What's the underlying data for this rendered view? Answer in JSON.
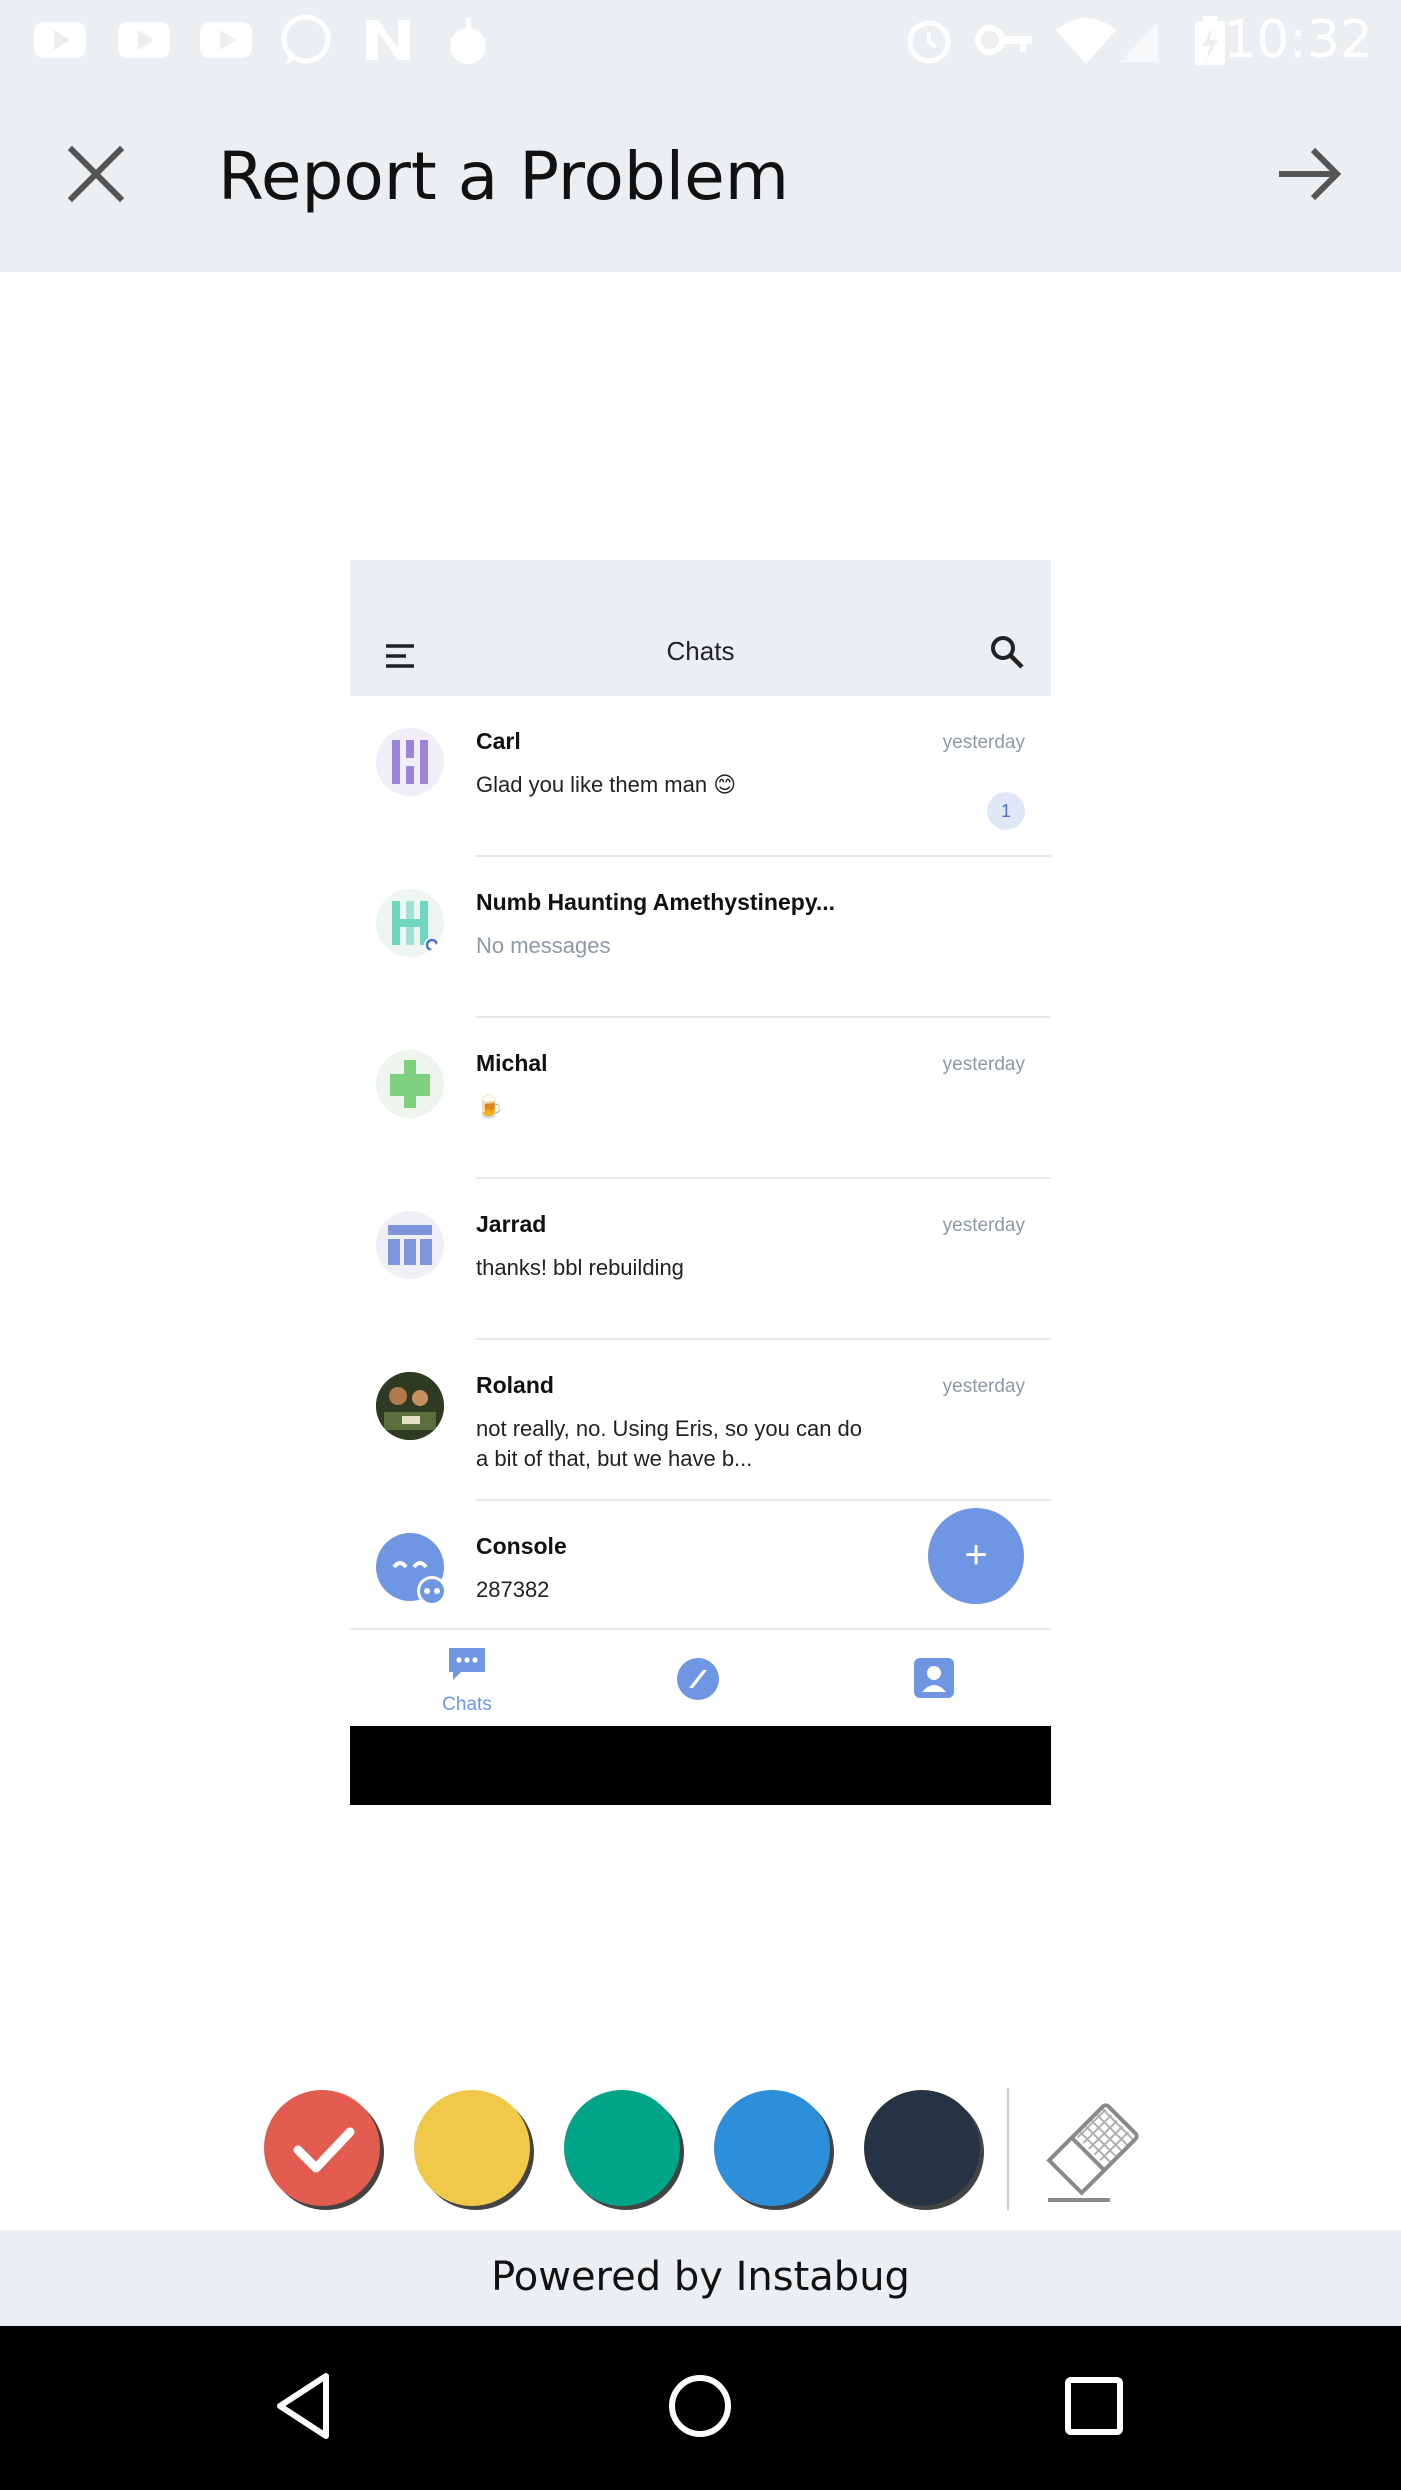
{
  "status_bar": {
    "time": "10:32",
    "icons": [
      "youtube-icon",
      "youtube-icon",
      "youtube-icon",
      "whatsapp-icon",
      "n-icon",
      "bomb-icon",
      "alarm-icon",
      "key-icon",
      "wifi-icon",
      "signal-icon",
      "battery-icon"
    ]
  },
  "app_bar": {
    "title": "Report a Problem",
    "close_icon": "close-icon",
    "next_icon": "arrow-right-icon"
  },
  "screenshot": {
    "header_title": "Chats",
    "chats": [
      {
        "name": "Carl",
        "message": "Glad you like them man 😊",
        "time": "yesterday",
        "badge": "1",
        "avatar_color": "#9c84d8"
      },
      {
        "name": "Numb Haunting Amethystinepy...",
        "message": "No messages",
        "time": "",
        "badge": "",
        "avatar_color": "#6fd6bf"
      },
      {
        "name": "Michal",
        "message": "🍺",
        "time": "yesterday",
        "badge": "",
        "avatar_color": "#7fd07c"
      },
      {
        "name": "Jarrad",
        "message": "thanks! bbl rebuilding",
        "time": "yesterday",
        "badge": "",
        "avatar_color": "#7f95dc"
      },
      {
        "name": "Roland",
        "message": "not really, no. Using Eris, so you can do a bit of that, but we have b...",
        "time": "yesterday",
        "badge": "",
        "avatar_color": "#3a4a2e"
      },
      {
        "name": "Console",
        "message": "287382",
        "time": "",
        "badge": "",
        "avatar_color": "#6f96e3"
      }
    ],
    "fab_label": "+",
    "nav_chats_label": "Chats",
    "accent": "#6f96e3"
  },
  "tools": {
    "colors": [
      "#e25d50",
      "#f0c94b",
      "#00a487",
      "#2d8fd9",
      "#263344"
    ],
    "selected_index": 0,
    "eraser_icon": "eraser-icon"
  },
  "footer": {
    "powered_by": "Powered by Instabug"
  }
}
